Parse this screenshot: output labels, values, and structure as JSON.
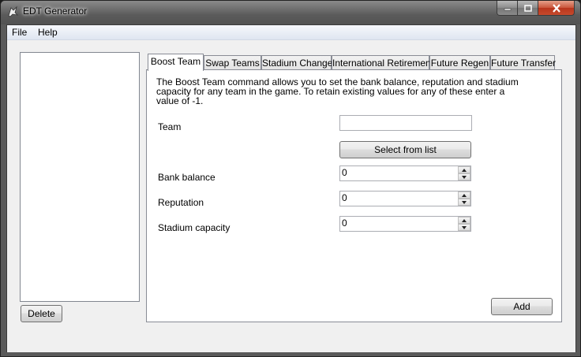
{
  "window": {
    "title": "EDT Generator",
    "icon": "app-logo-icon",
    "controls": [
      "minimize-icon",
      "maximize-icon",
      "close-icon"
    ]
  },
  "menu": {
    "items": [
      {
        "label": "File"
      },
      {
        "label": "Help"
      }
    ]
  },
  "left_panel": {
    "list_items": [],
    "delete_label": "Delete"
  },
  "tabs": [
    {
      "label": "Boost Team",
      "active": true
    },
    {
      "label": "Swap Teams",
      "active": false
    },
    {
      "label": "Stadium Change",
      "active": false
    },
    {
      "label": "International Retirement",
      "active": false
    },
    {
      "label": "Future Regen",
      "active": false
    },
    {
      "label": "Future Transfer",
      "active": false
    }
  ],
  "boost_team": {
    "description": "The Boost Team command allows you to set the bank balance, reputation and stadium capacity for any team in the game. To retain existing values for any of these enter a value of -1.",
    "team_label": "Team",
    "team_value": "",
    "select_button": "Select from list",
    "bank_label": "Bank balance",
    "bank_value": "0",
    "reputation_label": "Reputation",
    "reputation_value": "0",
    "stadium_label": "Stadium capacity",
    "stadium_value": "0",
    "add_button": "Add"
  }
}
